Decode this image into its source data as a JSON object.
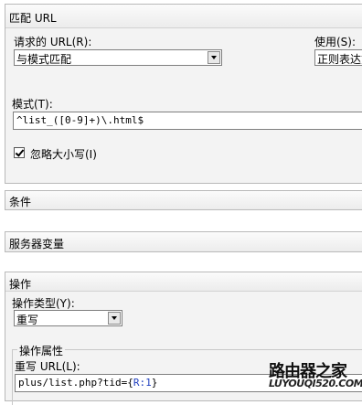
{
  "match_url": {
    "title": "匹配 URL",
    "requested_url_label": "请求的 URL(R):",
    "requested_url_value": "与模式匹配",
    "using_label": "使用(S):",
    "using_value": "正则表达式",
    "pattern_label": "模式(T):",
    "pattern_value": "^list_([0-9]+)\\.html$",
    "ignore_case_label": "忽略大小写(I)",
    "ignore_case_checked": true
  },
  "conditions": {
    "title": "条件"
  },
  "server_variables": {
    "title": "服务器变量"
  },
  "action": {
    "title": "操作",
    "action_type_label": "操作类型(Y):",
    "action_type_value": "重写",
    "properties_label": "操作属性",
    "rewrite_url_label": "重写 URL(L):",
    "rewrite_url_prefix": "plus/list.php?tid=",
    "rewrite_url_open": "{",
    "rewrite_url_ref": "R:1",
    "rewrite_url_close": "}"
  },
  "watermark": {
    "logo_text": "路由器之家",
    "url_text": "LUYOUQI520.COM"
  }
}
